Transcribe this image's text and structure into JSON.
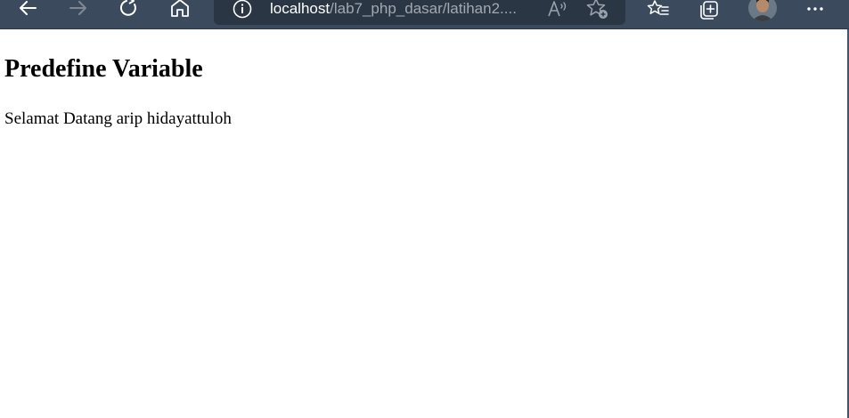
{
  "browser": {
    "url_host": "localhost",
    "url_path": "/lab7_php_dasar/latihan2....",
    "toolbar_color": "#3b4a5c",
    "address_bar_color": "#2b3644",
    "icons": {
      "back": "arrow-left-icon",
      "forward": "arrow-right-icon",
      "refresh": "refresh-icon",
      "home": "home-icon",
      "site_info": "info-icon",
      "read_aloud": "read-aloud-icon",
      "add_favorite": "star-add-icon",
      "favorites": "favorites-list-icon",
      "collections": "collections-icon",
      "profile": "profile-avatar",
      "menu": "more-horizontal-icon"
    }
  },
  "page": {
    "title": "Predefine Variable",
    "message": "Selamat Datang arip hidayattuloh"
  }
}
